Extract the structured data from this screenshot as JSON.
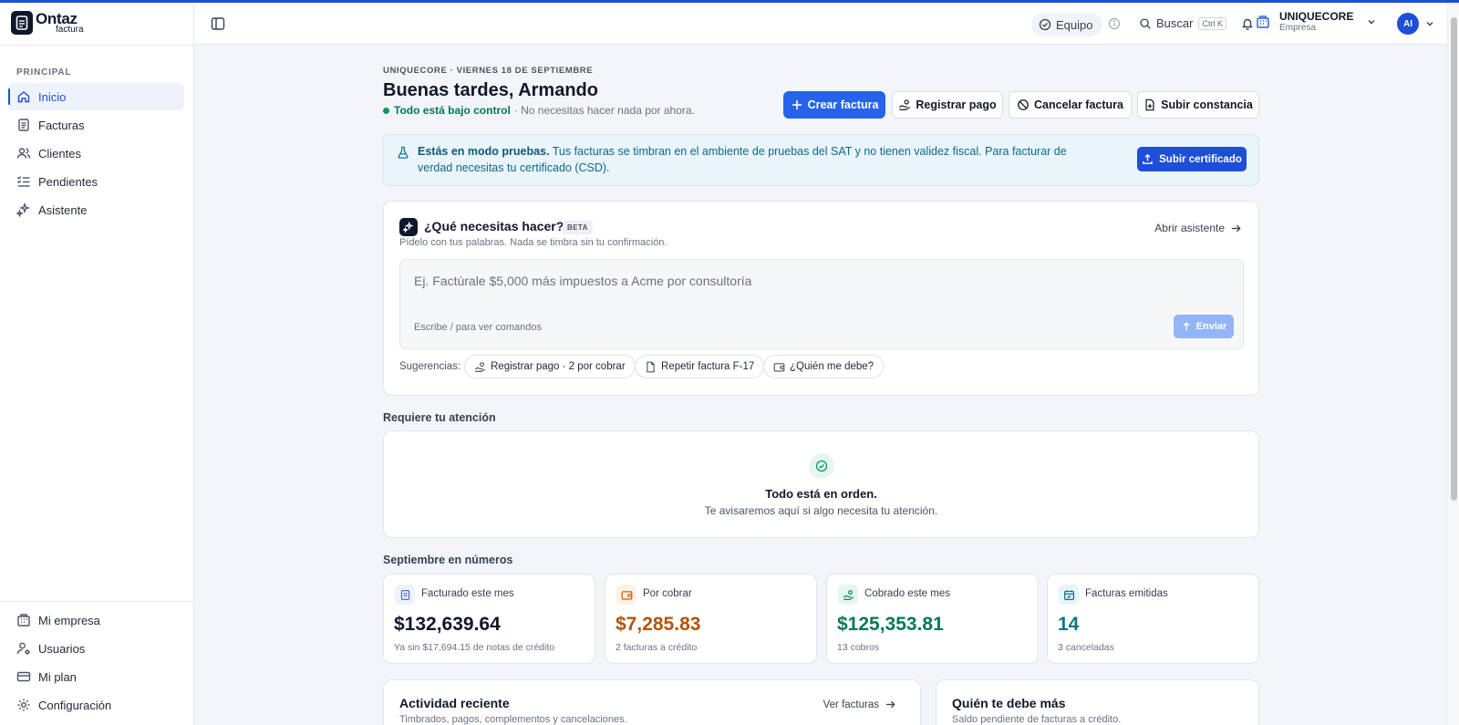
{
  "app": {
    "logo_main": "Ontaz",
    "logo_sub": "factura"
  },
  "sidebar": {
    "section_label": "PRINCIPAL",
    "items": [
      {
        "label": "Inicio",
        "icon": "home-icon",
        "active": true
      },
      {
        "label": "Facturas",
        "icon": "document-icon"
      },
      {
        "label": "Clientes",
        "icon": "users-icon"
      },
      {
        "label": "Pendientes",
        "icon": "checklist-icon"
      },
      {
        "label": "Asistente",
        "icon": "sparkles-icon"
      }
    ],
    "bottom_items": [
      {
        "label": "Mi empresa",
        "icon": "building-icon"
      },
      {
        "label": "Usuarios",
        "icon": "user-gear-icon"
      },
      {
        "label": "Mi plan",
        "icon": "credit-card-icon"
      },
      {
        "label": "Configuración",
        "icon": "gear-icon"
      }
    ]
  },
  "header": {
    "team_label": "Equipo",
    "search_label": "Buscar",
    "search_shortcut": "Ctrl K",
    "company_name": "UNIQUECORE",
    "company_role": "Empresa",
    "avatar_initials": "AI"
  },
  "main": {
    "eyebrow": "UNIQUECORE · VIERNES 18 DE SEPTIEMBRE",
    "greeting": "Buenas tardes, Armando",
    "status_ok": "Todo está bajo control",
    "status_rest": "· No necesitas hacer nada por ahora.",
    "actions": {
      "create": "Crear factura",
      "register_payment": "Registrar pago",
      "cancel": "Cancelar factura",
      "upload_cert": "Subir constancia"
    },
    "banner": {
      "bold": "Estás en modo pruebas.",
      "text": "Tus facturas se timbran en el ambiente de pruebas del SAT y no tienen validez fiscal. Para facturar de verdad necesitas tu certificado (CSD).",
      "button": "Subir certificado"
    },
    "assistant": {
      "title": "¿Qué necesitas hacer?",
      "badge": "BETA",
      "subtitle": "Pídelo con tus palabras. Nada se timbra sin tu confirmación.",
      "open_link": "Abrir asistente",
      "placeholder": "Ej. Factúrale $5,000 más impuestos a Acme por consultoría",
      "hint": "Escribe / para ver comandos",
      "send": "Enviar",
      "suggestions_label": "Sugerencias:",
      "suggestions": [
        "Registrar pago · 2 por cobrar",
        "Repetir factura F-17",
        "¿Quién me debe?"
      ]
    },
    "attention": {
      "title": "Requiere tu atención",
      "empty_title": "Todo está en orden.",
      "empty_sub": "Te avisaremos aquí si algo necesita tu atención."
    },
    "numbers": {
      "title": "Septiembre en números",
      "cards": [
        {
          "label": "Facturado este mes",
          "value": "$132,639.64",
          "note": "Ya sin $17,694.15 de notas de crédito",
          "color": "#0f172a",
          "icon": "document-icon"
        },
        {
          "label": "Por cobrar",
          "value": "$7,285.83",
          "note": "2 facturas a crédito",
          "color": "#b45309",
          "icon": "wallet-icon"
        },
        {
          "label": "Cobrado este mes",
          "value": "$125,353.81",
          "note": "13 cobros",
          "color": "#047857",
          "icon": "hand-coins-icon"
        },
        {
          "label": "Facturas emitidas",
          "value": "14",
          "note": "3 canceladas",
          "color": "#0e7490",
          "icon": "calendar-icon"
        }
      ]
    },
    "activity": {
      "title": "Actividad reciente",
      "subtitle": "Timbrados, pagos, complementos y cancelaciones.",
      "link": "Ver facturas"
    },
    "debtors": {
      "title": "Quién te debe más",
      "subtitle": "Saldo pendiente de facturas a crédito."
    }
  }
}
